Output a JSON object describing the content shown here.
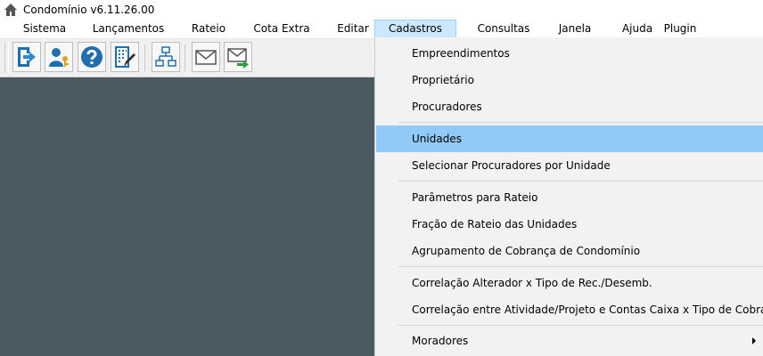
{
  "window": {
    "title": "Condomínio v6.11.26.00",
    "icon": "home-icon"
  },
  "menubar": {
    "items": [
      {
        "label": "Sistema"
      },
      {
        "label": "Lançamentos"
      },
      {
        "label": "Rateio"
      },
      {
        "label": "Cota Extra"
      },
      {
        "label": "Editar"
      },
      {
        "label": "Cadastros",
        "active": true
      },
      {
        "label": "Consultas"
      },
      {
        "label": "Janela"
      },
      {
        "label": "Ajuda"
      },
      {
        "label": "Plugin"
      }
    ]
  },
  "toolbar": {
    "buttons": [
      {
        "icon": "exit-door-icon"
      },
      {
        "icon": "user-key-icon"
      },
      {
        "icon": "help-icon"
      },
      {
        "icon": "building-edit-icon"
      },
      {
        "icon": "org-chart-icon"
      },
      {
        "icon": "envelope-icon"
      },
      {
        "icon": "send-mail-icon"
      }
    ]
  },
  "dropdown": {
    "menu": "Cadastros",
    "selected_index": 3,
    "items": [
      {
        "label": "Empreendimentos"
      },
      {
        "label": "Proprietário"
      },
      {
        "label": "Procuradores"
      },
      {
        "label": "Unidades"
      },
      {
        "label": "Selecionar Procuradores por Unidade"
      },
      {
        "label": "Parâmetros para Rateio"
      },
      {
        "label": "Fração de Rateio das Unidades"
      },
      {
        "label": "Agrupamento de Cobrança de Condomínio"
      },
      {
        "label": "Correlação Alterador x Tipo de Rec./Desemb."
      },
      {
        "label": "Correlação entre Atividade/Projeto e Contas Caixa x Tipo de Cobrança"
      },
      {
        "label": "Moradores",
        "submenu": true
      }
    ]
  },
  "colors": {
    "workspace": "#4b5a62",
    "menu_highlight": "#91c9f7",
    "active_menu": "#cce8ff",
    "toolbar_bg": "#f0f0f0",
    "dropdown_bg": "#f2f2f2"
  }
}
